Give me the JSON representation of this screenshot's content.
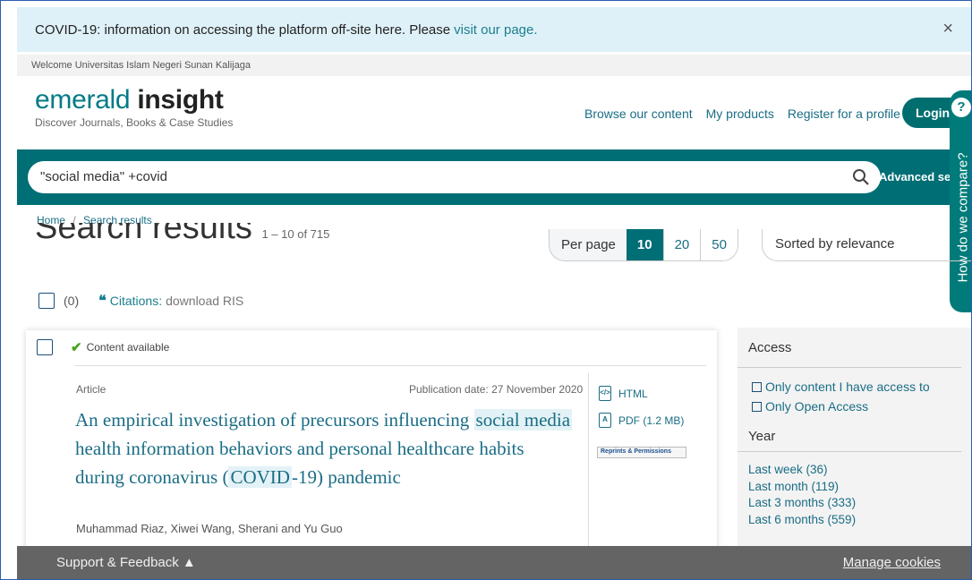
{
  "banner": {
    "text": "COVID-19: information on accessing the platform off-site here. Please",
    "link": "visit our page.",
    "close": "×"
  },
  "welcome": "Welcome Universitas Islam Negeri Sunan Kalijaga",
  "logo": {
    "light": "emerald",
    "bold": "insight",
    "tagline": "Discover Journals, Books & Case Studies"
  },
  "nav": {
    "browse": "Browse our content",
    "products": "My products",
    "register": "Register for a profile",
    "login": "Login"
  },
  "search": {
    "query": "\"social media\" +covid",
    "advanced": "Advanced searc"
  },
  "sidetab": {
    "q": "?",
    "text": "How do we compare?"
  },
  "breadcrumb": {
    "home": "Home",
    "sep": "/",
    "current": "Search results"
  },
  "results": {
    "title": "Search results",
    "count": "1 – 10 of 715"
  },
  "perpage": {
    "label": "Per page",
    "options": [
      "10",
      "20",
      "50"
    ],
    "active": "10"
  },
  "sort": "Sorted by relevance",
  "citations": {
    "zero": "(0)",
    "quote": "❝",
    "label": "Citations:",
    "action": "download RIS"
  },
  "card": {
    "availability": "Content available",
    "type": "Article",
    "pubdate": "Publication date: 27 November 2020",
    "title_pre": "An empirical investigation of precursors influencing",
    "title_hl1": "social media",
    "title_mid": "health information behaviors and personal healthcare habits during coronavirus (",
    "title_hl2": "COVID",
    "title_post": "-19) pandemic",
    "authors": "Muhammad Riaz, Xiwei Wang, Sherani and Yu Guo",
    "html": "HTML",
    "pdf": "PDF (1.2 MB)",
    "reprints": "Reprints & Permissions"
  },
  "filters": {
    "access_title": "Access",
    "access": [
      "Only content I have access to",
      "Only Open Access"
    ],
    "year_title": "Year",
    "years": [
      "Last week (36)",
      "Last month (119)",
      "Last 3 months (333)",
      "Last 6 months (559)"
    ]
  },
  "footer": {
    "support": "Support & Feedback ▲",
    "cookies": "Manage cookies"
  },
  "colors": {
    "brand": "#006e75",
    "link": "#1a6d85",
    "banner": "#dff1f8",
    "footer": "#646464"
  }
}
